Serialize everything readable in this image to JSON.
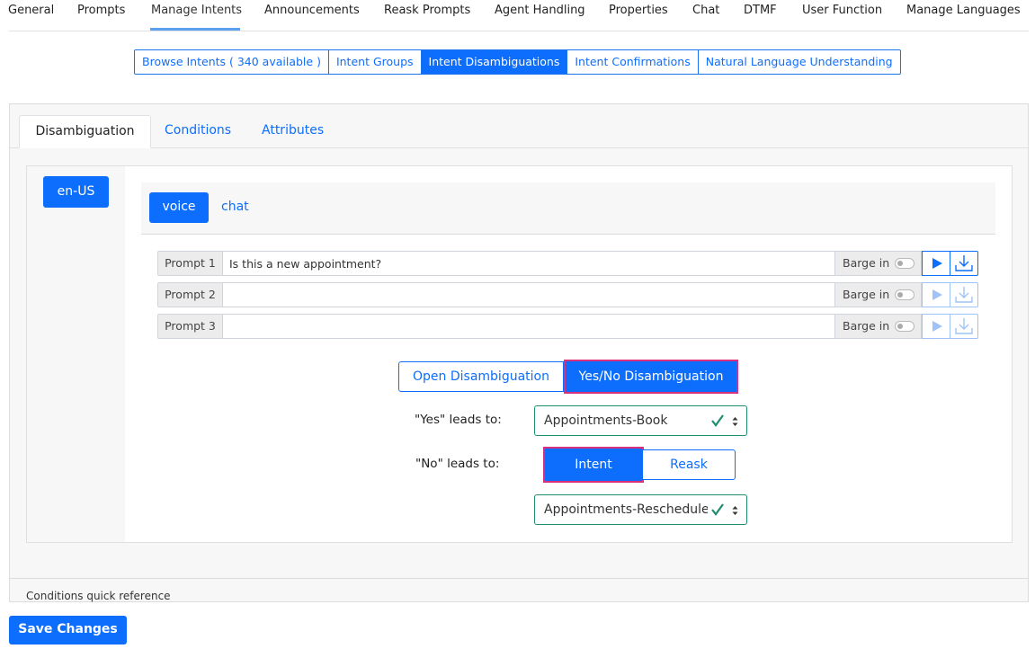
{
  "top_nav": {
    "tabs": [
      {
        "label": "General"
      },
      {
        "label": "Prompts"
      },
      {
        "label": "Manage Intents"
      },
      {
        "label": "Announcements"
      },
      {
        "label": "Reask Prompts"
      },
      {
        "label": "Agent Handling"
      },
      {
        "label": "Properties"
      },
      {
        "label": "Chat"
      },
      {
        "label": "DTMF"
      },
      {
        "label": "User Function"
      },
      {
        "label": "Manage Languages"
      }
    ],
    "active": "Manage Intents"
  },
  "sub_tabs": {
    "items": [
      {
        "label": "Browse Intents ( 340 available )"
      },
      {
        "label": "Intent Groups"
      },
      {
        "label": "Intent Disambiguations"
      },
      {
        "label": "Intent Confirmations"
      },
      {
        "label": "Natural Language Understanding"
      }
    ],
    "active": "Intent Disambiguations"
  },
  "panel_tabs": {
    "items": [
      {
        "label": "Disambiguation"
      },
      {
        "label": "Conditions"
      },
      {
        "label": "Attributes"
      }
    ],
    "active": "Disambiguation"
  },
  "language": {
    "label": "en-US"
  },
  "channels": {
    "voice": "voice",
    "chat": "chat",
    "active": "voice"
  },
  "prompts": [
    {
      "label": "Prompt 1",
      "value": "Is this a new appointment?",
      "barge_label": "Barge in",
      "barge_on": false
    },
    {
      "label": "Prompt 2",
      "value": "",
      "barge_label": "Barge in",
      "barge_on": false
    },
    {
      "label": "Prompt 3",
      "value": "",
      "barge_label": "Barge in",
      "barge_on": false
    }
  ],
  "disambiguation_type": {
    "open_label": "Open Disambiguation",
    "yesno_label": "Yes/No Disambiguation",
    "selected": "Yes/No Disambiguation"
  },
  "yes_leads_to": {
    "label": "\"Yes\" leads to:",
    "value": "Appointments-Book"
  },
  "no_leads_to": {
    "label": "\"No\" leads to:",
    "intent_label": "Intent",
    "reask_label": "Reask",
    "selected": "Intent",
    "value": "Appointments-Reschedule"
  },
  "conditions_quick_reference": "Conditions quick reference",
  "save_label": "Save Changes",
  "colors": {
    "primary": "#0d6efd",
    "highlight": "#d9307e",
    "valid": "#1e8e6e"
  }
}
